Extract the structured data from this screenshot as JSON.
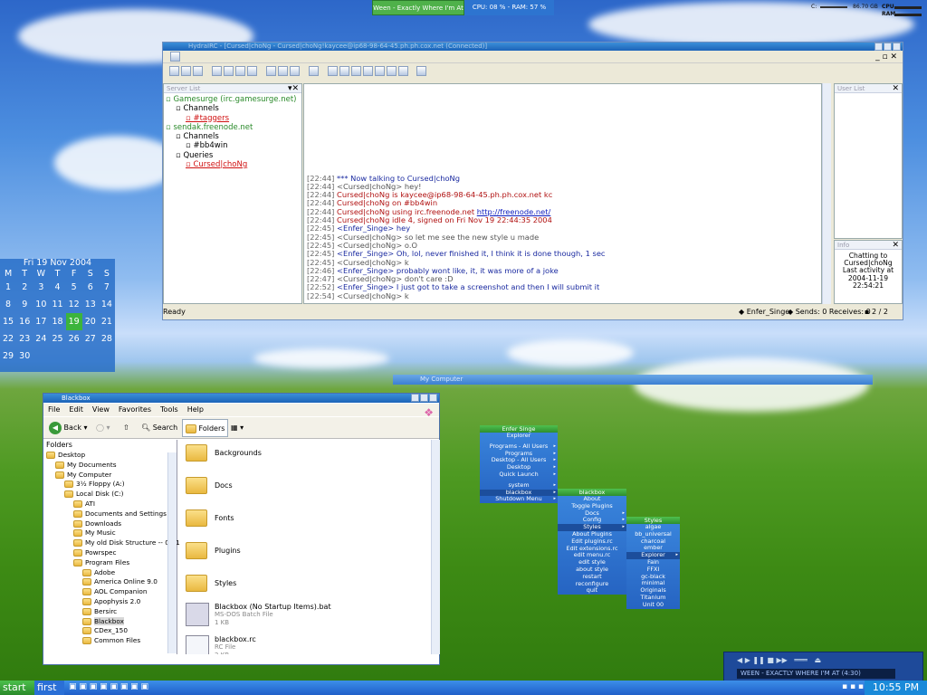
{
  "top_widgets": {
    "song": "Ween - Exactly Where I'm At",
    "cpu_ram": "CPU: 08 % - RAM: 57 %",
    "disk_free": "86.70 GB",
    "disk_drive": "C:",
    "cpu_label": "CPU",
    "ram_label": "RAM"
  },
  "mirc": {
    "title": "HydraIRC - [Cursed|choNg - Cursed|choNg!kaycee@ip68-98-64-45.ph.ph.cox.net (Connected)]",
    "serverlist_title": "Server List",
    "tree": [
      {
        "label": "Gamesurge (irc.gamesurge.net)",
        "color": "#2a8a2a",
        "indent": 0
      },
      {
        "label": "Channels",
        "color": "#000000",
        "indent": 1
      },
      {
        "label": "#taggers",
        "color": "#d01010",
        "indent": 2
      },
      {
        "label": "sendak.freenode.net",
        "color": "#2a8a2a",
        "indent": 0
      },
      {
        "label": "Channels",
        "color": "#000000",
        "indent": 1
      },
      {
        "label": "#bb4win",
        "color": "#000000",
        "indent": 2
      },
      {
        "label": "Queries",
        "color": "#000000",
        "indent": 1
      },
      {
        "label": "Cursed|choNg",
        "color": "#d01010",
        "indent": 2
      }
    ],
    "chat": [
      {
        "time": "[22:44]",
        "text": "*** Now talking to Cursed|choNg",
        "color": "#1a2aa0"
      },
      {
        "time": "[22:44]",
        "text": "<Cursed|choNg> hey!",
        "color": "#555555"
      },
      {
        "time": "[22:44]",
        "text": "Cursed|choNg is kaycee@ip68-98-64-45.ph.ph.cox.net kc",
        "color": "#b01010"
      },
      {
        "time": "[22:44]",
        "text": "Cursed|choNg on #bb4win",
        "color": "#b01010"
      },
      {
        "time": "[22:44]",
        "text": "Cursed|choNg using irc.freenode.net ",
        "color": "#b01010",
        "link": "http://freenode.net/"
      },
      {
        "time": "[22:44]",
        "text": "Cursed|choNg idle 4, signed on Fri Nov 19 22:44:35 2004",
        "color": "#b01010"
      },
      {
        "time": "[22:45]",
        "text": "<Enfer_Singe> hey",
        "color": "#1a2aa0"
      },
      {
        "time": "[22:45]",
        "text": "<Cursed|choNg> so let me see the new style u made",
        "color": "#555555"
      },
      {
        "time": "[22:45]",
        "text": "<Cursed|choNg> o.O",
        "color": "#555555"
      },
      {
        "time": "[22:45]",
        "text": "<Enfer_Singe> Oh, lol, never finished it, I think it is done though, 1 sec",
        "color": "#1a2aa0"
      },
      {
        "time": "[22:45]",
        "text": "<Cursed|choNg> k",
        "color": "#555555"
      },
      {
        "time": "[22:46]",
        "text": "<Enfer_Singe> probably wont like, it, it was more of a joke",
        "color": "#1a2aa0"
      },
      {
        "time": "[22:47]",
        "text": "<Cursed|choNg> don't care :D",
        "color": "#555555"
      },
      {
        "time": "[22:52]",
        "text": "<Enfer_Singe> I just got to take a screenshot and then I will submit it",
        "color": "#1a2aa0"
      },
      {
        "time": "[22:54]",
        "text": "<Cursed|choNg> k",
        "color": "#555555"
      }
    ],
    "userlist_title": "User List",
    "info_title": "Info",
    "info_lines": [
      "Chatting to",
      "Cursed|choNg",
      "Last activity at",
      "2004-11-19",
      "22:54:21"
    ],
    "status_ready": "Ready",
    "status_nick": "Enfer_Singe",
    "status_sends": "Sends: 0 Receives: 0",
    "status_pages": "2 / 2"
  },
  "calendar": {
    "title": "Fri 19 Nov  2004",
    "weekdays": [
      "M",
      "T",
      "W",
      "T",
      "F",
      "S",
      "S"
    ],
    "weeks": [
      [
        "1",
        "2",
        "3",
        "4",
        "5",
        "6",
        "7"
      ],
      [
        "8",
        "9",
        "10",
        "11",
        "12",
        "13",
        "14"
      ],
      [
        "15",
        "16",
        "17",
        "18",
        "19",
        "20",
        "21"
      ],
      [
        "22",
        "23",
        "24",
        "25",
        "26",
        "27",
        "28"
      ],
      [
        "29",
        "30",
        "",
        "",
        "",
        "",
        ""
      ]
    ],
    "today": "19"
  },
  "explorer": {
    "title": "Blackbox",
    "menu": [
      "File",
      "Edit",
      "View",
      "Favorites",
      "Tools",
      "Help"
    ],
    "back": "Back",
    "search": "Search",
    "folders_btn": "Folders",
    "folders_title": "Folders",
    "tree": [
      {
        "label": "Desktop",
        "indent": 0
      },
      {
        "label": "My Documents",
        "indent": 1
      },
      {
        "label": "My Computer",
        "indent": 1
      },
      {
        "label": "3½ Floppy (A:)",
        "indent": 2
      },
      {
        "label": "Local Disk (C:)",
        "indent": 2
      },
      {
        "label": "ATI",
        "indent": 3
      },
      {
        "label": "Documents and Settings",
        "indent": 3
      },
      {
        "label": "Downloads",
        "indent": 3
      },
      {
        "label": "My Music",
        "indent": 3
      },
      {
        "label": "My old Disk Structure -- 04-1",
        "indent": 3
      },
      {
        "label": "Powrspec",
        "indent": 3
      },
      {
        "label": "Program Files",
        "indent": 3
      },
      {
        "label": "Adobe",
        "indent": 4
      },
      {
        "label": "America Online 9.0",
        "indent": 4
      },
      {
        "label": "AOL Companion",
        "indent": 4
      },
      {
        "label": "Apophysis 2.0",
        "indent": 4
      },
      {
        "label": "Bersirc",
        "indent": 4
      },
      {
        "label": "Blackbox",
        "indent": 4
      },
      {
        "label": "CDex_150",
        "indent": 4
      },
      {
        "label": "Common Files",
        "indent": 4
      }
    ],
    "files": [
      {
        "name": "Backgrounds",
        "type": "",
        "size": ""
      },
      {
        "name": "Docs",
        "type": "",
        "size": ""
      },
      {
        "name": "Fonts",
        "type": "",
        "size": ""
      },
      {
        "name": "Plugins",
        "type": "",
        "size": ""
      },
      {
        "name": "Styles",
        "type": "",
        "size": ""
      },
      {
        "name": "Blackbox (No Startup Items).bat",
        "type": "MS-DOS Batch File",
        "size": "1 KB"
      },
      {
        "name": "blackbox.rc",
        "type": "RC File",
        "size": "2 KB"
      }
    ]
  },
  "my_computer_title": "My Computer",
  "bbmenu1": {
    "title": "Enfer Singe",
    "items": [
      "Explorer",
      "",
      "Programs - All Users",
      "Programs",
      "Desktop - All Users",
      "Desktop",
      "Quick Launch",
      "",
      "system",
      "blackbox",
      "Shutdown Menu"
    ]
  },
  "bbmenu2": {
    "title": "blackbox",
    "items": [
      "About",
      "Toggle Plugins",
      "Docs",
      "Config",
      "Styles",
      "About Plugins",
      "Edit plugins.rc",
      "Edit extensions.rc",
      "edit menu.rc",
      "edit style",
      "about style",
      "restart",
      "reconfigure",
      "quit"
    ]
  },
  "bbmenu3": {
    "title": "Styles",
    "items": [
      "algae",
      "bb_universal",
      "charcoal",
      "ember",
      "Explorer",
      "Fain",
      "FFXI",
      "gc-black",
      "minimal",
      "Originals",
      "Titanium",
      "Unit 00"
    ]
  },
  "player": {
    "track": "WEEN - EXACTLY WHERE I'M AT (4:30)"
  },
  "taskbar": {
    "start": "start",
    "workspace": "first",
    "clock": "10:55 PM"
  }
}
